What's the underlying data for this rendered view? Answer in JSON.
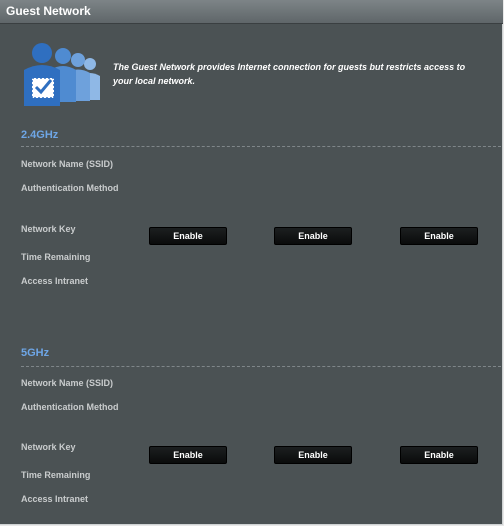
{
  "header": {
    "title": "Guest Network"
  },
  "intro": {
    "icon": "guest-users-icon",
    "text": "The Guest Network provides Internet connection for guests but restricts access to your local network."
  },
  "bands": [
    {
      "name": "2.4GHz",
      "labels": {
        "ssid": "Network Name (SSID)",
        "auth": "Authentication Method",
        "key": "Network Key",
        "time": "Time Remaining",
        "intranet": "Access Intranet"
      },
      "buttons": [
        "Enable",
        "Enable",
        "Enable"
      ]
    },
    {
      "name": "5GHz",
      "labels": {
        "ssid": "Network Name (SSID)",
        "auth": "Authentication Method",
        "key": "Network Key",
        "time": "Time Remaining",
        "intranet": "Access Intranet"
      },
      "buttons": [
        "Enable",
        "Enable",
        "Enable"
      ]
    }
  ],
  "colors": {
    "panel": "#4b5254",
    "band_title": "#6ea6e6",
    "label": "#c9cccd",
    "button": "#0f1112"
  }
}
